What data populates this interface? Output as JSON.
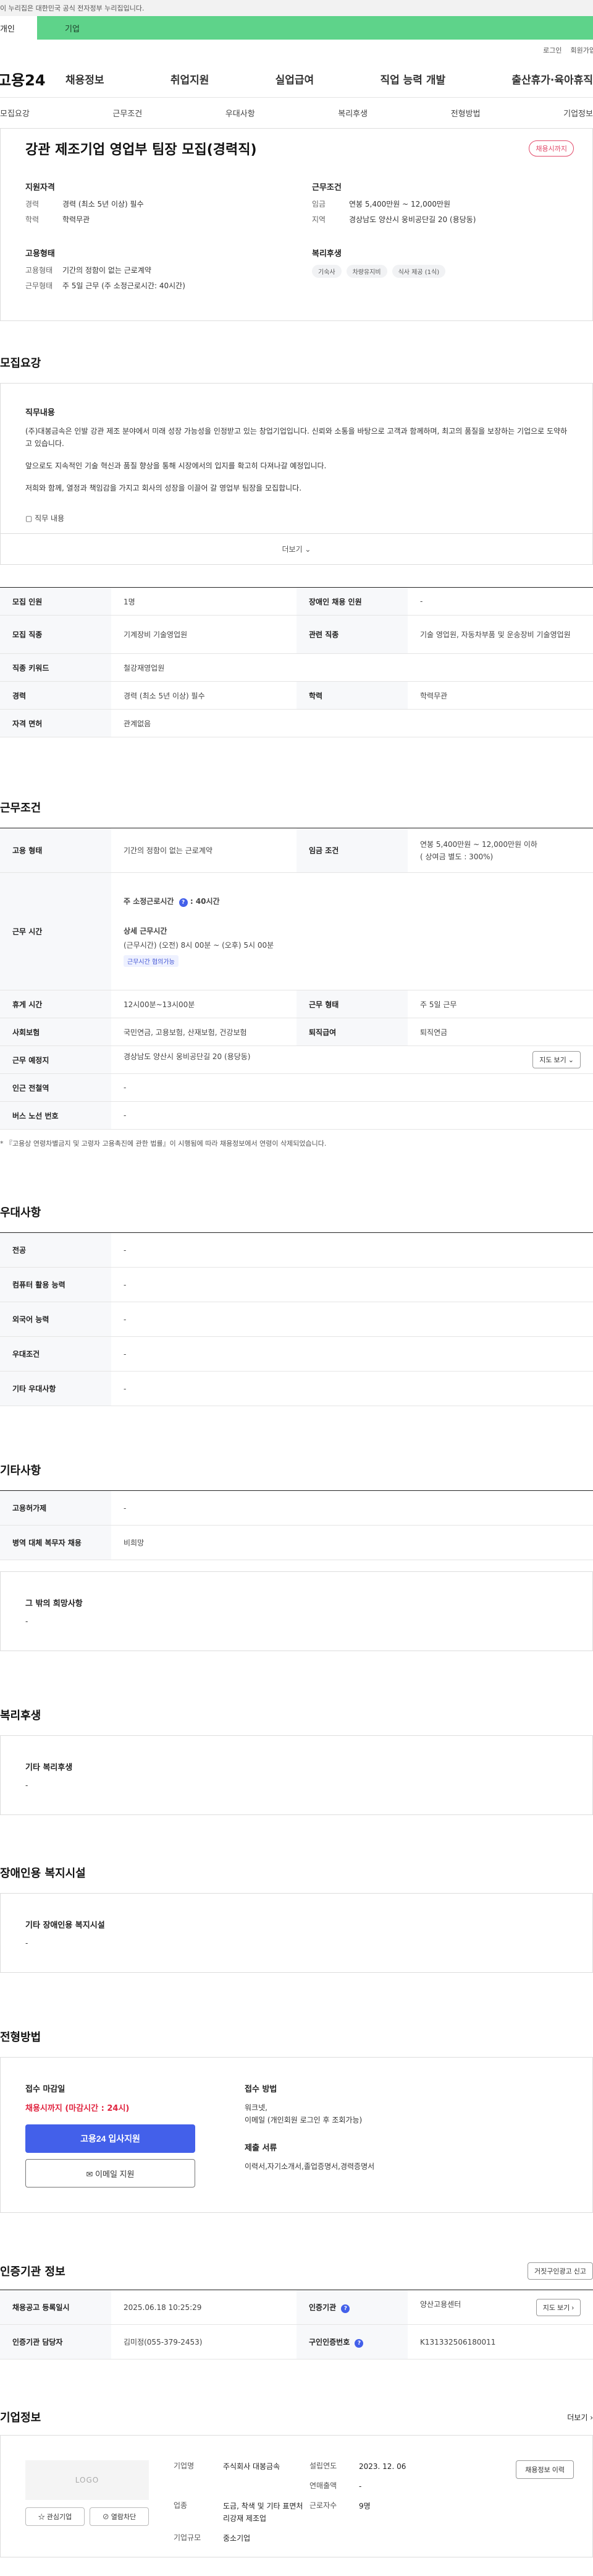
{
  "gov_banner": "이 누리집은 대한민국 공식 전자정부 누리집입니다.",
  "login_tabs": {
    "person": "개인",
    "company": "기업"
  },
  "util": {
    "login": "로그인",
    "join": "회원가입"
  },
  "gnb": {
    "logo": "고용24",
    "menu": [
      "채용정보",
      "취업지원",
      "실업급여",
      "직업 능력 개발",
      "출산휴가·육아휴직"
    ]
  },
  "anchor_nav": [
    "모집요강",
    "근무조건",
    "우대사항",
    "복리후생",
    "전형방법",
    "기업정보"
  ],
  "summary": {
    "title": "강관 제조기업 영업부 팀장 모집(경력직)",
    "badge": "채용시까지",
    "qual": {
      "title": "지원자격",
      "career_k": "경력",
      "career_v": "경력 (최소 5년 이상) 필수",
      "edu_k": "학력",
      "edu_v": "학력무관"
    },
    "cond": {
      "title": "근무조건",
      "wage_k": "임금",
      "wage_v": "연봉 5,400만원 ~ 12,000만원",
      "area_k": "지역",
      "area_v": "경상남도 양산시 웅비공단길 20 (용당동)"
    },
    "emp": {
      "title": "고용형태",
      "type_k": "고용형태",
      "type_v": "기간의 정함이 없는 근로계약",
      "work_k": "근무형태",
      "work_v": "주 5일 근무 (주 소정근로시간: 40시간)"
    },
    "welfare": {
      "title": "복리후생",
      "chips": [
        "기숙사",
        "차량유지비",
        "식사 제공 (1식)"
      ]
    }
  },
  "recruit": {
    "title": "모집요강",
    "desc_title": "직무내용",
    "desc_p1": "(주)대봉금속은 인발 강관 제조 분야에서 미래 성장 가능성을 인정받고 있는 창업기업입니다. 신뢰와 소통을 바탕으로 고객과 함께하며, 최고의 품질을 보장하는 기업으로 도약하고 있습니다.",
    "desc_p2": "앞으로도 지속적인 기술 혁신과 품질 향상을 통해 시장에서의 입지를 확고히 다져나갈 예정입니다.",
    "desc_p3": "저희와 함께, 열정과 책임감을 가지고 회사의 성장을 이끌어 갈 영업부 팀장을 모집합니다.",
    "desc_check": "▢ 직무 내용",
    "more": "더보기 ⌄",
    "rows": [
      {
        "k1": "모집 인원",
        "v1": "1명",
        "k2": "장애인 채용 인원",
        "v2": "-"
      },
      {
        "k1": "모집 직종",
        "v1": "기계장비 기술영업원",
        "k2": "관련 직종",
        "v2": "기술 영업원, 자동차부품 및 운송장비 기술영업원"
      },
      {
        "k1": "직종 키워드",
        "v1": "철강재영업원",
        "k2": "",
        "v2": ""
      },
      {
        "k1": "경력",
        "v1": "경력 (최소 5년 이상) 필수",
        "k2": "학력",
        "v2": "학력무관"
      },
      {
        "k1": "자격 면허",
        "v1": "관계없음",
        "k2": "",
        "v2": ""
      }
    ]
  },
  "work": {
    "title": "근무조건",
    "emp_k": "고용 형태",
    "emp_v": "기간의 정함이 없는 근로계약",
    "wage_k": "임금 조건",
    "wage_v": "연봉 5,400만원 ~ 12,000만원 이하",
    "wage_sub": "( 상여금 별도 : 300%)",
    "time_k": "근무 시간",
    "time_week": "주 소정근로시간",
    "time_week_v": "40시간",
    "time_detail_t": "상세 근무시간",
    "time_detail_v": "(근무시간) (오전) 8시 00분 ~ (오후) 5시 00분",
    "time_tag": "근무시간 협의가능",
    "rest_k": "휴게 시간",
    "rest_v": "12시00분~13시00분",
    "form_k": "근무 형태",
    "form_v": "주 5일 근무",
    "ins_k": "사회보험",
    "ins_v": "국민연금, 고용보험, 산재보험, 건강보험",
    "ret_k": "퇴직급여",
    "ret_v": "퇴직연금",
    "loc_k": "근무 예정지",
    "loc_v": "경상남도 양산시 웅비공단길 20 (용당동)",
    "map_btn": "지도 보기 ⌄",
    "sub_k": "인근 전철역",
    "sub_v": "-",
    "bus_k": "버스 노선 번호",
    "bus_v": "-",
    "note": "* 『고용상 연령차별금지 및 고령자 고용촉진에 관한 법률』이 시행됨에 따라 채용정보에서 연령이 삭제되었습니다."
  },
  "pref": {
    "title": "우대사항",
    "rows": [
      {
        "k": "전공",
        "v": "-"
      },
      {
        "k": "컴퓨터 활용 능력",
        "v": "-"
      },
      {
        "k": "외국어 능력",
        "v": "-"
      },
      {
        "k": "우대조건",
        "v": "-"
      },
      {
        "k": "기타 우대사항",
        "v": "-"
      }
    ]
  },
  "etc": {
    "title": "기타사항",
    "rows": [
      {
        "k": "고용허가제",
        "v": "-"
      },
      {
        "k": "병역 대체 복무자 채용",
        "v": "비희망"
      }
    ],
    "box_t": "그 밖의 희망사항",
    "box_v": "-"
  },
  "welfare": {
    "title": "복리후생",
    "box_t": "기타 복리후생",
    "box_v": "-"
  },
  "disabled": {
    "title": "장애인용 복지시설",
    "box_t": "기타 장애인용 복지시설",
    "box_v": "-"
  },
  "apply": {
    "title": "전형방법",
    "deadline_t": "접수 마감일",
    "deadline_v": "채용시까지 (마감시간 : 24시)",
    "apply_btn": "고용24 입사지원",
    "email_btn": "✉ 이메일 지원",
    "method_t": "접수 방법",
    "method_v": "워크넷,\n이메일 (개인회원 로그인 후 조회가능)",
    "docs_t": "제출 서류",
    "docs_v": "이력서,자기소개서,졸업증명서,경력증명서"
  },
  "agency": {
    "title": "인증기관 정보",
    "report_btn": "거짓구인광고 신고",
    "r1": {
      "k1": "채용공고 등록일시",
      "v1": "2025.06.18 10:25:29",
      "k2": "인증기관",
      "v2": "양산고용센터",
      "btn": "지도 보기 ›"
    },
    "r2": {
      "k1": "인증기관 담당자",
      "v1": "김미정(055-379-2453)",
      "k2": "구인인증번호",
      "v2": "K131332506180011"
    }
  },
  "company": {
    "title": "기업정보",
    "more": "더보기 ›",
    "logo": "LOGO",
    "fav_btn": "☆ 관심기업",
    "block_btn": "⊘ 열람차단",
    "name_k": "기업명",
    "name_v": "주식회사 대봉금속",
    "year_k": "설립연도",
    "year_v": "2023. 12. 06",
    "biz_btn": "채용정보 이력",
    "sales_k": "연매출액",
    "sales_v": "-",
    "ind_k": "업종",
    "ind_v": "도금, 착색 및 기타 표면처리강재 제조업",
    "emp_k": "근로자수",
    "emp_v": "9명",
    "size_k": "기업규모",
    "size_v": "중소기업"
  }
}
